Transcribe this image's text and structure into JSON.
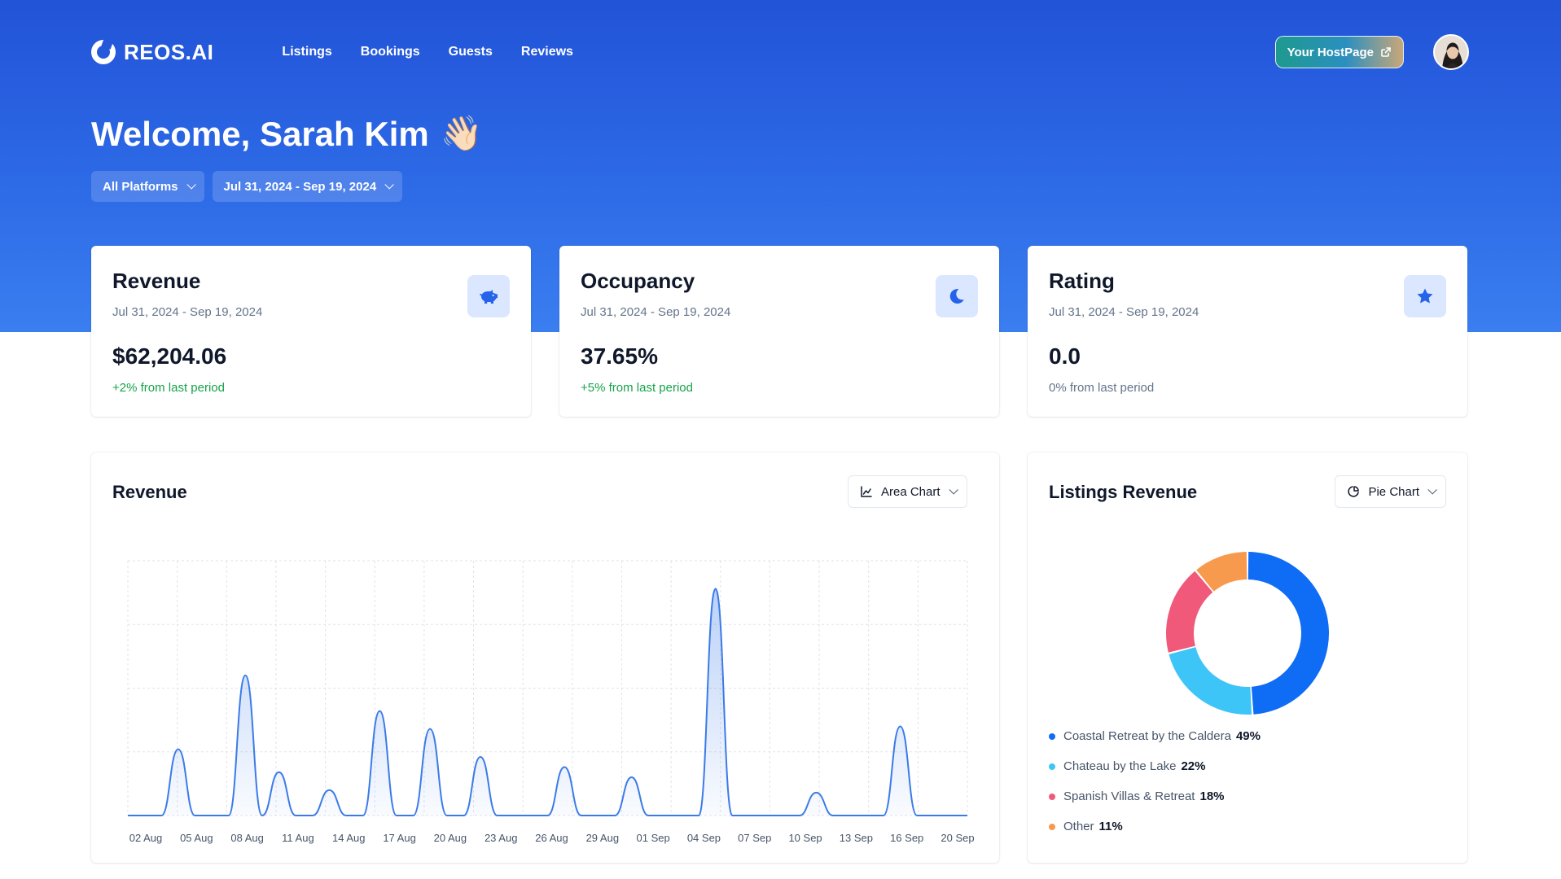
{
  "app": {
    "logo_text": "REOS.AI"
  },
  "nav": {
    "items": [
      "Listings",
      "Bookings",
      "Guests",
      "Reviews"
    ]
  },
  "header": {
    "hostpage_label": "Your HostPage",
    "welcome": "Welcome, Sarah Kim",
    "welcome_emoji": "👋🏻"
  },
  "filters": {
    "platform": "All Platforms",
    "date_range": "Jul 31, 2024 - Sep 19, 2024"
  },
  "stats": [
    {
      "title": "Revenue",
      "range": "Jul 31, 2024 - Sep 19, 2024",
      "value": "$62,204.06",
      "change": "+2% from last period",
      "icon": "piggy-bank-icon",
      "trend": "positive"
    },
    {
      "title": "Occupancy",
      "range": "Jul 31, 2024 - Sep 19, 2024",
      "value": "37.65%",
      "change": "+5% from last period",
      "icon": "moon-icon",
      "trend": "positive"
    },
    {
      "title": "Rating",
      "range": "Jul 31, 2024 - Sep 19, 2024",
      "value": "0.0",
      "change": "0% from last period",
      "icon": "star-icon",
      "trend": "neutral"
    }
  ],
  "revenue_panel": {
    "title": "Revenue",
    "chart_type_label": "Area Chart"
  },
  "listings_panel": {
    "title": "Listings Revenue",
    "chart_type_label": "Pie Chart"
  },
  "colors": {
    "accent": "#2563eb",
    "positive": "#16a34a",
    "area_line": "#3b7be8"
  },
  "chart_data": [
    {
      "type": "area",
      "title": "Revenue",
      "x_tick_labels": [
        "02 Aug",
        "05 Aug",
        "08 Aug",
        "11 Aug",
        "14 Aug",
        "17 Aug",
        "20 Aug",
        "23 Aug",
        "26 Aug",
        "29 Aug",
        "01 Sep",
        "04 Sep",
        "07 Sep",
        "10 Sep",
        "13 Sep",
        "16 Sep",
        "20 Sep"
      ],
      "x": [
        "31 Jul",
        "01 Aug",
        "02 Aug",
        "03 Aug",
        "04 Aug",
        "05 Aug",
        "06 Aug",
        "07 Aug",
        "08 Aug",
        "09 Aug",
        "10 Aug",
        "11 Aug",
        "12 Aug",
        "13 Aug",
        "14 Aug",
        "15 Aug",
        "16 Aug",
        "17 Aug",
        "18 Aug",
        "19 Aug",
        "20 Aug",
        "21 Aug",
        "22 Aug",
        "23 Aug",
        "24 Aug",
        "25 Aug",
        "26 Aug",
        "27 Aug",
        "28 Aug",
        "29 Aug",
        "30 Aug",
        "31 Aug",
        "01 Sep",
        "02 Sep",
        "03 Sep",
        "04 Sep",
        "05 Sep",
        "06 Sep",
        "07 Sep",
        "08 Sep",
        "09 Sep",
        "10 Sep",
        "11 Sep",
        "12 Sep",
        "13 Sep",
        "14 Sep",
        "15 Sep",
        "16 Sep",
        "17 Sep",
        "18 Sep",
        "19 Sep"
      ],
      "values": [
        0,
        0,
        0,
        260,
        0,
        0,
        0,
        550,
        0,
        170,
        0,
        0,
        100,
        0,
        0,
        410,
        0,
        0,
        340,
        0,
        0,
        230,
        0,
        0,
        0,
        0,
        190,
        0,
        0,
        0,
        150,
        0,
        0,
        0,
        0,
        890,
        0,
        0,
        0,
        0,
        0,
        90,
        0,
        0,
        0,
        0,
        350,
        0,
        0,
        0,
        0,
        0,
        0,
        0,
        0,
        0,
        0,
        0,
        0,
        0,
        0,
        0,
        0,
        0,
        0,
        0,
        0,
        0,
        0,
        0,
        0
      ],
      "grid": true,
      "ylim": [
        0,
        1000
      ]
    },
    {
      "type": "pie",
      "title": "Listings Revenue",
      "labels": [
        "Coastal Retreat by the Caldera",
        "Chateau by the Lake",
        "Spanish Villas & Retreat",
        "Other"
      ],
      "values": [
        49,
        22,
        18,
        11
      ],
      "colors": [
        "#0f6cf5",
        "#3ec5f7",
        "#f0597a",
        "#f79a4e"
      ],
      "label_pcts": [
        "49%",
        "22%",
        "18%",
        "11%"
      ],
      "donut": true
    }
  ]
}
